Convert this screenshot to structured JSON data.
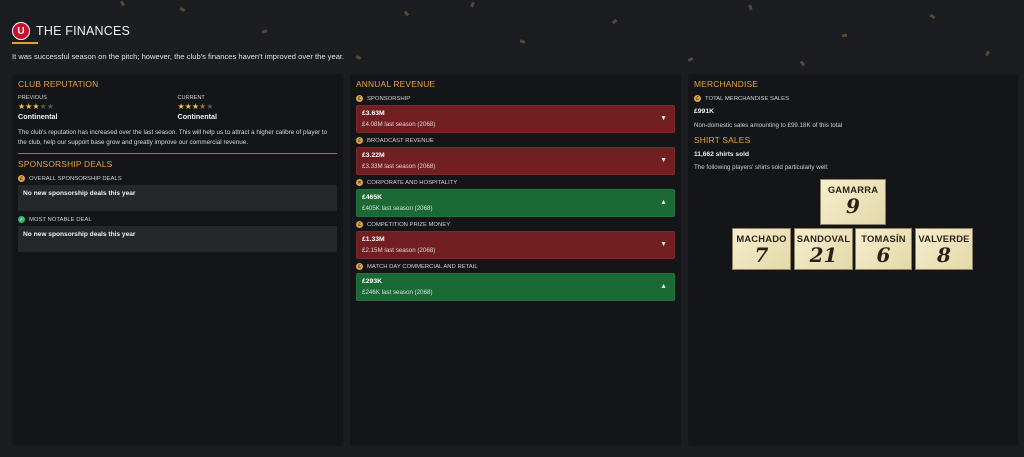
{
  "header": {
    "club_badge": "U",
    "title": "THE FINANCES",
    "summary": "It was successful season on the pitch; however, the club's finances haven't improved over the year."
  },
  "club_reputation": {
    "title": "CLUB REPUTATION",
    "previous": {
      "label": "PREVIOUS",
      "value": "Continental",
      "stars": 3,
      "max_stars": 5
    },
    "current": {
      "label": "CURRENT",
      "value": "Continental",
      "stars": 3.5,
      "max_stars": 5
    },
    "description": "The club's reputation has increased over the last season. This will help us to attract a higher calibre of player to the club, help our support base grow and greatly improve our commercial revenue."
  },
  "sponsorship_deals": {
    "title": "SPONSORSHIP DEALS",
    "overall": {
      "label": "OVERALL SPONSORSHIP DEALS",
      "value": "No new sponsorship deals this year",
      "icon": "coin-icon"
    },
    "notable": {
      "label": "MOST NOTABLE DEAL",
      "value": "No new sponsorship deals this year",
      "icon": "handshake-icon"
    }
  },
  "annual_revenue": {
    "title": "ANNUAL REVENUE",
    "items": [
      {
        "label": "SPONSORSHIP",
        "amount": "£3.63M",
        "previous": "£4.08M last season (2068)",
        "trend": "down"
      },
      {
        "label": "BROADCAST REVENUE",
        "amount": "£3.22M",
        "previous": "£3.33M last season (2068)",
        "trend": "down"
      },
      {
        "label": "CORPORATE AND HOSPITALITY",
        "amount": "£465K",
        "previous": "£405K last season (2068)",
        "trend": "up"
      },
      {
        "label": "COMPETITION PRIZE MONEY",
        "amount": "£1.33M",
        "previous": "£2.15M last season (2068)",
        "trend": "down"
      },
      {
        "label": "MATCH DAY COMMERCIAL AND RETAIL",
        "amount": "£293K",
        "previous": "£246K last season (2068)",
        "trend": "up"
      }
    ],
    "trend_glyphs": {
      "down": "▼",
      "up": "▲"
    }
  },
  "merchandise": {
    "title": "MERCHANDISE",
    "total_label": "TOTAL MERCHANDISE SALES",
    "total_value": "£991K",
    "note": "Non-domestic sales amounting to £99.18K of this total"
  },
  "shirt_sales": {
    "title": "SHIRT SALES",
    "total": "11,662 shirts sold",
    "note": "The following players' shirts sold particularly well:",
    "shirts": [
      {
        "name": "GAMARRA",
        "number": "9"
      },
      {
        "name": "MACHADO",
        "number": "7"
      },
      {
        "name": "SANDOVAL",
        "number": "21"
      },
      {
        "name": "TOMASÍN",
        "number": "6"
      },
      {
        "name": "VALVERDE",
        "number": "8"
      }
    ]
  },
  "colors": {
    "accent": "#e3a33a",
    "decline": "#711f21",
    "growth": "#1b6a35",
    "star": "#f2c43c"
  }
}
